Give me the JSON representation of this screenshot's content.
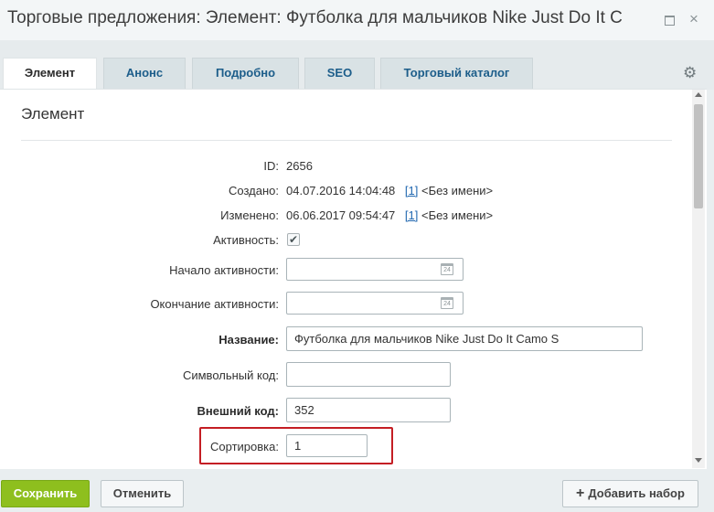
{
  "window": {
    "title": "Торговые предложения: Элемент: Футболка для мальчиков Nike Just Do It C"
  },
  "tabs": [
    {
      "label": "Элемент"
    },
    {
      "label": "Анонс"
    },
    {
      "label": "Подробно"
    },
    {
      "label": "SEO"
    },
    {
      "label": "Торговый каталог"
    }
  ],
  "section": {
    "title": "Элемент"
  },
  "fields": {
    "id": {
      "label": "ID:",
      "value": "2656"
    },
    "created": {
      "label": "Создано:",
      "date": "04.07.2016 14:04:48",
      "link": "[1]",
      "user": "<Без имени>"
    },
    "modified": {
      "label": "Изменено:",
      "date": "06.06.2017 09:54:47",
      "link": "[1]",
      "user": "<Без имени>"
    },
    "active": {
      "label": "Активность:",
      "checked": true
    },
    "active_from": {
      "label": "Начало активности:",
      "value": ""
    },
    "active_to": {
      "label": "Окончание активности:",
      "value": ""
    },
    "name": {
      "label": "Название:",
      "value": "Футболка для мальчиков Nike Just Do It Camo S"
    },
    "code": {
      "label": "Символьный код:",
      "value": ""
    },
    "xml_id": {
      "label": "Внешний код:",
      "value": "352"
    },
    "sort": {
      "label": "Сортировка:",
      "value": "1"
    }
  },
  "icons": {
    "calendar_glyph": "24",
    "checkmark": "✔",
    "gear": "⚙",
    "close": "×",
    "plus": "+"
  },
  "footer": {
    "save_label": "Сохранить",
    "cancel_label": "Отменить",
    "add_set_label": "Добавить набор"
  },
  "colors": {
    "save_button": "#8ebf1e",
    "highlight": "#c41e24",
    "link": "#2067b0"
  }
}
